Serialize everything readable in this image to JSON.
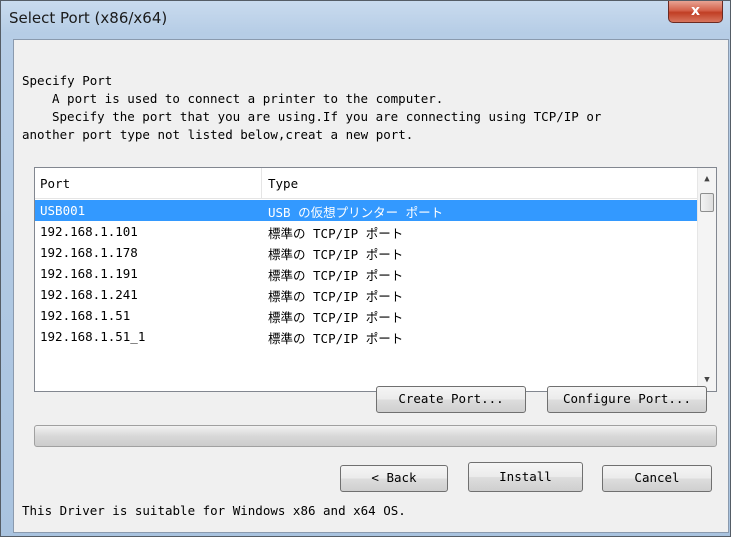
{
  "window": {
    "title": "Select Port (x86/x64)",
    "close_label": "x"
  },
  "intro": {
    "heading": "Specify Port",
    "line1": "A port is used to connect a printer to the computer.",
    "line2": "Specify the port that you are using.If you are connecting using TCP/IP or",
    "line3": "another port type not listed below,creat a new port."
  },
  "port_list": {
    "columns": [
      "Port",
      "Type"
    ],
    "rows": [
      {
        "port": "USB001",
        "type": "USB の仮想プリンター ポート",
        "selected": true
      },
      {
        "port": "192.168.1.101",
        "type": "標準の TCP/IP ポート",
        "selected": false
      },
      {
        "port": "192.168.1.178",
        "type": "標準の TCP/IP ポート",
        "selected": false
      },
      {
        "port": "192.168.1.191",
        "type": "標準の TCP/IP ポート",
        "selected": false
      },
      {
        "port": "192.168.1.241",
        "type": "標準の TCP/IP ポート",
        "selected": false
      },
      {
        "port": "192.168.1.51",
        "type": "標準の TCP/IP ポート",
        "selected": false
      },
      {
        "port": "192.168.1.51_1",
        "type": "標準の TCP/IP ポート",
        "selected": false
      }
    ]
  },
  "buttons": {
    "create_port": "Create Port...",
    "configure_port": "Configure Port...",
    "back": "< Back",
    "install": "Install",
    "cancel": "Cancel"
  },
  "progress": {
    "value": 0
  },
  "footer": {
    "note": "This Driver is suitable for Windows x86 and x64 OS."
  }
}
